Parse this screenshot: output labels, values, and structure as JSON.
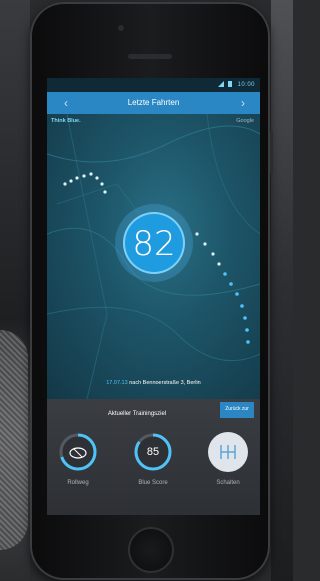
{
  "app": {
    "title": "Letzte Fahrten",
    "status_time": "10:00",
    "label_left": "Think Blue.",
    "label_right": "Google"
  },
  "score": {
    "value": "82"
  },
  "trip": {
    "date": "17.07.13",
    "text": "nach Bennoerstraße 3, Berlin"
  },
  "panel": {
    "focus_label": "Aktueller Trainingsziel",
    "badge_label": "Zurück zur",
    "metrics": [
      {
        "label": "Rollweg",
        "value": "",
        "progress": 0.7
      },
      {
        "label": "Blue Score",
        "value": "85",
        "progress": 0.85
      },
      {
        "label": "Schalten",
        "value": "",
        "progress": 1.0
      }
    ]
  },
  "colors": {
    "accent": "#2b86c4",
    "score_blue": "#1f9be0",
    "light_blue": "#4fc3f7"
  },
  "icons": {
    "back": "chevron-left-icon",
    "forward": "chevron-right-icon",
    "car": "car-icon",
    "gear": "gear-shift-icon"
  }
}
